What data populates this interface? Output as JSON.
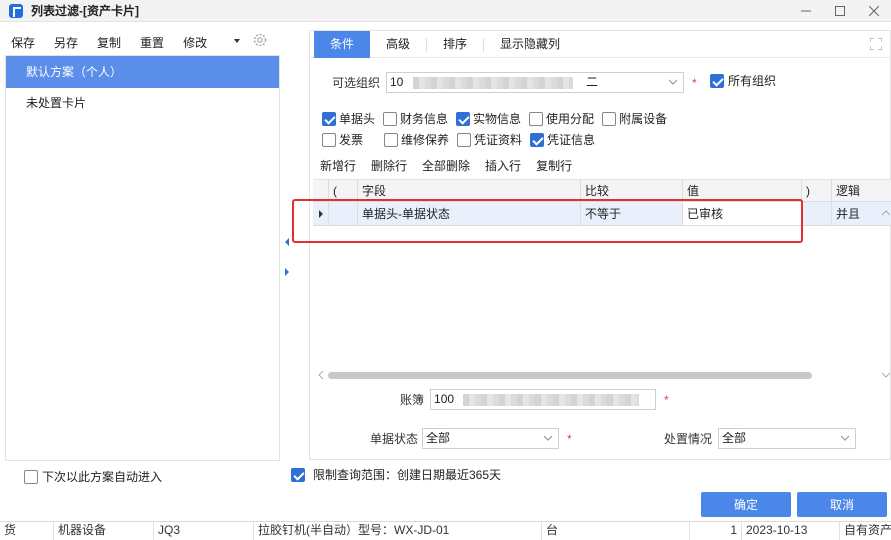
{
  "window": {
    "title": "列表过滤-[资产卡片]",
    "accent": "#4a87e8"
  },
  "left": {
    "toolbar": [
      "保存",
      "另存",
      "复制",
      "重置",
      "修改"
    ],
    "schemes": [
      {
        "label": "默认方案（个人）",
        "selected": true
      },
      {
        "label": "未处置卡片",
        "selected": false
      }
    ],
    "auto_enter_label": "下次以此方案自动进入",
    "auto_enter_checked": false
  },
  "tabs": [
    "条件",
    "高级",
    "排序",
    "显示隐藏列"
  ],
  "org": {
    "label": "可选组织",
    "value_prefix": "10",
    "value_suffix": "二",
    "all_org_label": "所有组织",
    "all_org_checked": true
  },
  "checkboxes": {
    "row1": [
      {
        "label": "单据头",
        "checked": true
      },
      {
        "label": "财务信息",
        "checked": false
      },
      {
        "label": "实物信息",
        "checked": true
      },
      {
        "label": "使用分配",
        "checked": false
      },
      {
        "label": "附属设备",
        "checked": false
      }
    ],
    "row2": [
      {
        "label": "发票",
        "checked": false
      },
      {
        "label": "维修保养",
        "checked": false
      },
      {
        "label": "凭证资料",
        "checked": false
      },
      {
        "label": "凭证信息",
        "checked": true
      }
    ]
  },
  "grid_toolbar": [
    "新增行",
    "删除行",
    "全部删除",
    "插入行",
    "复制行"
  ],
  "grid": {
    "headers": [
      "(",
      "字段",
      "比较",
      "值",
      ")",
      "逻辑"
    ],
    "rows": [
      {
        "open": "",
        "field": "单据头-单据状态",
        "compare": "不等于",
        "value": "已审核",
        "close": "",
        "logic": "并且"
      }
    ]
  },
  "book": {
    "label": "账簿",
    "value_prefix": "100"
  },
  "doc_status": {
    "label": "单据状态",
    "value": "全部"
  },
  "disposal": {
    "label": "处置情况",
    "value": "全部"
  },
  "limit": {
    "label": "限制查询范围：创建日期最近365天",
    "checked": true
  },
  "buttons": {
    "ok": "确定",
    "cancel": "取消"
  },
  "background_row": [
    "货",
    "机器设备",
    "JQ3",
    "拉胶钉机(半自动）型号：WX-JD-01",
    "台",
    "1",
    "2023-10-13",
    "自有资产"
  ]
}
